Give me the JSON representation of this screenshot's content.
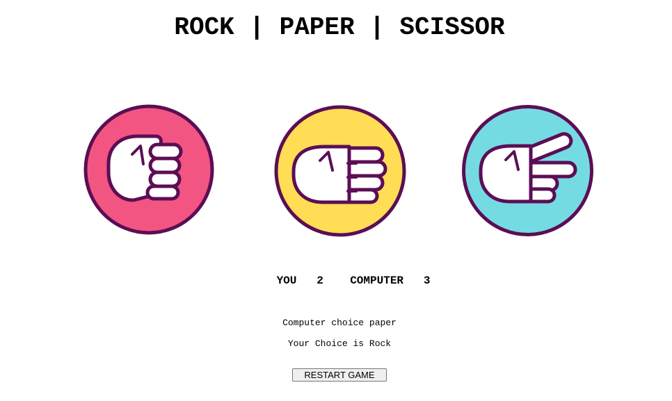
{
  "header": {
    "title": "ROCK | PAPER | SCISSOR"
  },
  "choices": [
    {
      "id": "rock",
      "icon": "fist-icon",
      "color": "#f25582"
    },
    {
      "id": "paper",
      "icon": "open-hand-icon",
      "color": "#ffdd55"
    },
    {
      "id": "scissor",
      "icon": "scissors-hand-icon",
      "color": "#75dbe3"
    }
  ],
  "colors": {
    "outline": "#5b0e55",
    "hand_fill": "#ffffff"
  },
  "scoreboard": {
    "you_label": "YOU",
    "you_score": "2",
    "computer_label": "COMPUTER",
    "computer_score": "3"
  },
  "messages": {
    "computer_choice": "Computer choice paper",
    "user_choice": "Your Choice is Rock"
  },
  "controls": {
    "restart_label": "RESTART GAME"
  }
}
